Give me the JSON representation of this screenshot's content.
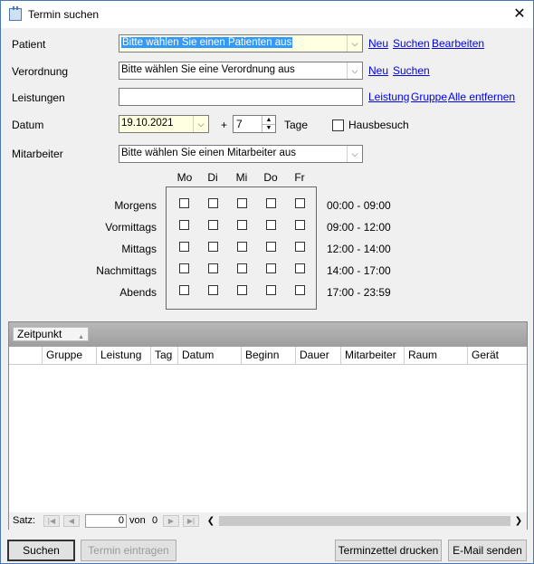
{
  "window": {
    "title": "Termin suchen",
    "close": "✕"
  },
  "form": {
    "patient": {
      "label": "Patient",
      "value": "Bitte wählen Sie einen Patienten aus",
      "links": [
        "Neu",
        "Suchen",
        "Bearbeiten"
      ]
    },
    "verordnung": {
      "label": "Verordnung",
      "value": "Bitte wählen Sie eine Verordnung aus",
      "links": [
        "Neu",
        "Suchen"
      ]
    },
    "leistungen": {
      "label": "Leistungen",
      "value": "",
      "links": [
        "Leistung",
        "Gruppe",
        "Alle entfernen"
      ]
    },
    "datum": {
      "label": "Datum",
      "value": "19.10.2021",
      "plus": "+",
      "days": "7",
      "days_label": "Tage",
      "hausbesuch": "Hausbesuch"
    },
    "mitarbeiter": {
      "label": "Mitarbeiter",
      "value": "Bitte wählen Sie einen Mitarbeiter aus"
    }
  },
  "schedule": {
    "days": [
      "Mo",
      "Di",
      "Mi",
      "Do",
      "Fr"
    ],
    "periods": [
      {
        "name": "Morgens",
        "time": "00:00 - 09:00"
      },
      {
        "name": "Vormittags",
        "time": "09:00 - 12:00"
      },
      {
        "name": "Mittags",
        "time": "12:00 - 14:00"
      },
      {
        "name": "Nachmittags",
        "time": "14:00 - 17:00"
      },
      {
        "name": "Abends",
        "time": "17:00 - 23:59"
      }
    ]
  },
  "table": {
    "group_by": "Zeitpunkt",
    "columns": [
      "Gruppe",
      "Leistung",
      "Tag",
      "Datum",
      "Beginn",
      "Dauer",
      "Mitarbeiter",
      "Raum",
      "Gerät"
    ],
    "nav": {
      "label": "Satz:",
      "page": "0",
      "of": "von",
      "total": "0"
    }
  },
  "buttons": {
    "suchen": "Suchen",
    "termin_eintragen": "Termin eintragen",
    "terminzettel": "Terminzettel drucken",
    "email": "E-Mail senden"
  }
}
